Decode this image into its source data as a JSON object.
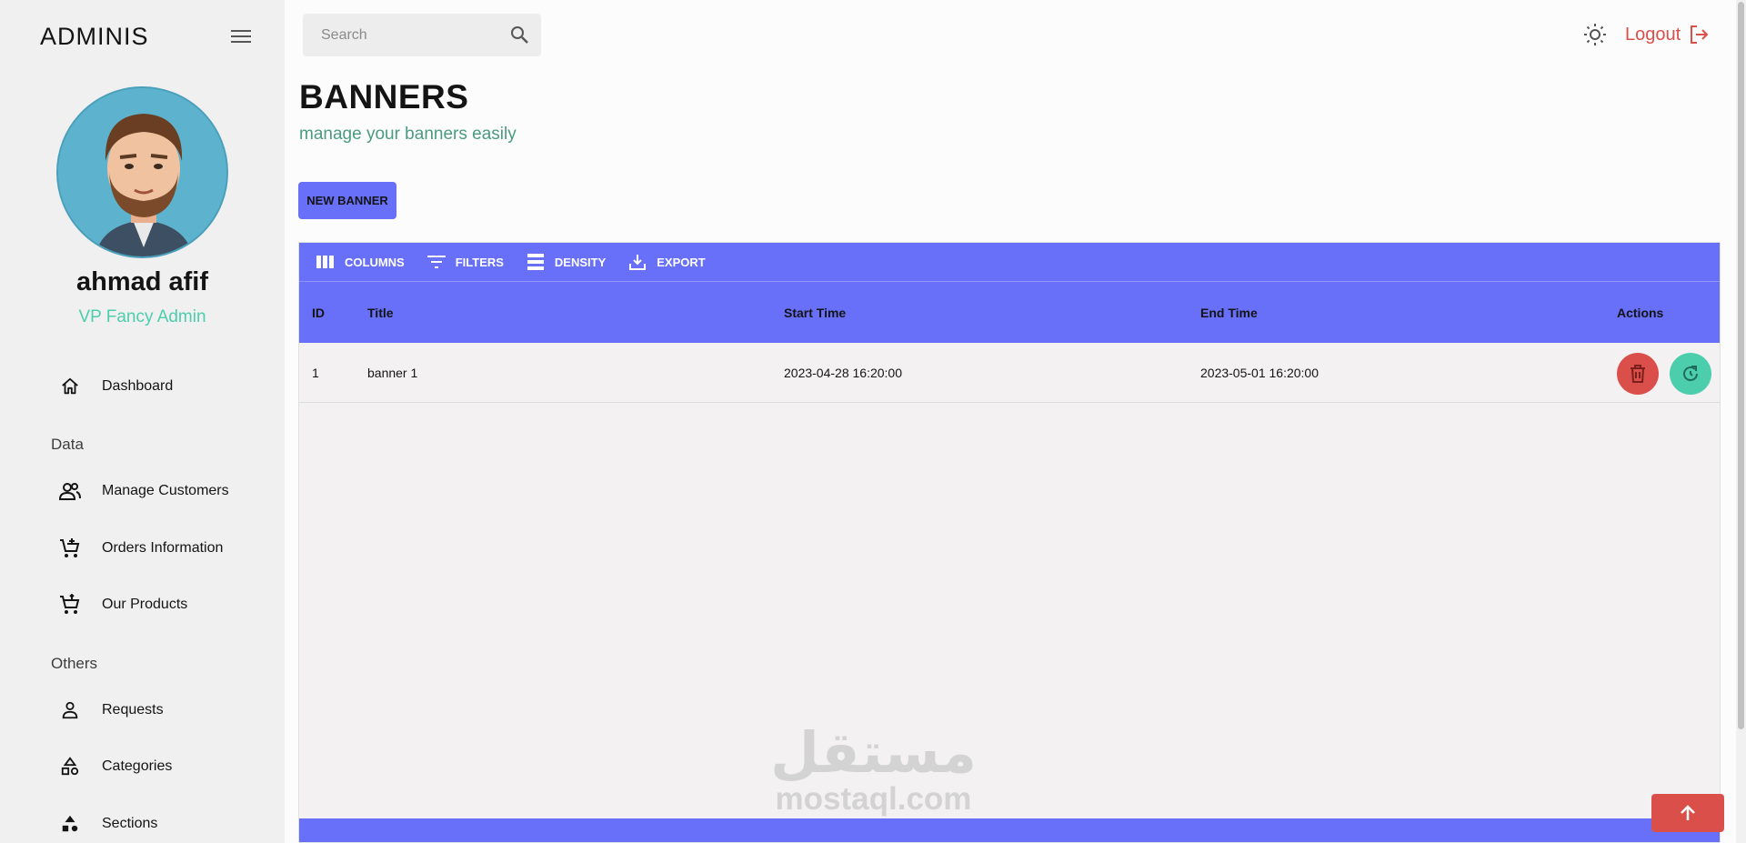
{
  "sidebar": {
    "brand": "ADMINIS",
    "profile": {
      "name": "ahmad afif",
      "role": "VP Fancy Admin"
    },
    "items": [
      {
        "label": "Dashboard",
        "icon": "home-icon"
      },
      {
        "label": "Manage Customers",
        "icon": "people-icon"
      },
      {
        "label": "Orders Information",
        "icon": "cart-add-icon"
      },
      {
        "label": "Our Products",
        "icon": "cart-icon"
      },
      {
        "label": "Requests",
        "icon": "person-icon"
      },
      {
        "label": "Categories",
        "icon": "shapes-icon"
      },
      {
        "label": "Sections",
        "icon": "category-icon"
      }
    ],
    "sections": [
      "Data",
      "Others"
    ]
  },
  "topbar": {
    "search_placeholder": "Search",
    "logout_label": "Logout"
  },
  "header": {
    "title": "BANNERS",
    "subtitle": "manage your banners easily"
  },
  "actions": {
    "new_banner": "NEW BANNER"
  },
  "grid": {
    "toolbar": [
      "COLUMNS",
      "FILTERS",
      "DENSITY",
      "EXPORT"
    ],
    "columns": [
      "ID",
      "Title",
      "Start Time",
      "End Time",
      "Actions"
    ],
    "rows": [
      {
        "id": "1",
        "title": "banner 1",
        "start_time": "2023-04-28 16:20:00",
        "end_time": "2023-05-01 16:20:00"
      }
    ]
  },
  "watermark": {
    "arabic": "مستقل",
    "latin": "mostaql.com"
  },
  "colors": {
    "primary": "#6870fa",
    "accent_green": "#4cceac",
    "danger": "#db4f4a",
    "sidebar_bg": "#f1f0f0"
  }
}
